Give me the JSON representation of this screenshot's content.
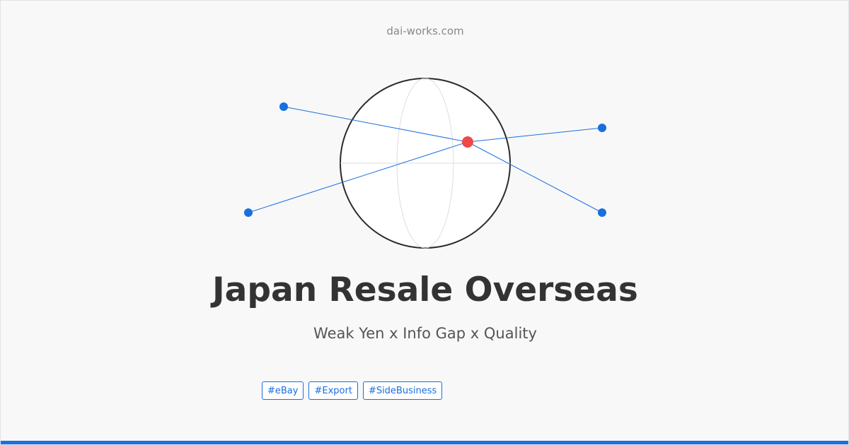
{
  "site": {
    "name": "dai-works.com"
  },
  "hero": {
    "title": "Japan Resale Overseas",
    "subtitle": "Weak Yen x Info Gap x Quality"
  },
  "tags": [
    {
      "label": "#eBay"
    },
    {
      "label": "#Export"
    },
    {
      "label": "#SideBusiness"
    }
  ],
  "illustration": {
    "icon": "globe-connections-icon",
    "colors": {
      "globe_stroke": "#2b2b2b",
      "globe_gridline": "#dddddd",
      "connection_line": "#1a6fe0",
      "endpoint_dot": "#1a6fe0",
      "hub_dot": "#f04848"
    }
  },
  "colors": {
    "accent": "#1a6fe0",
    "background": "#f8f8f8",
    "title": "#333333",
    "subtitle": "#555555",
    "site_name": "#888888"
  }
}
